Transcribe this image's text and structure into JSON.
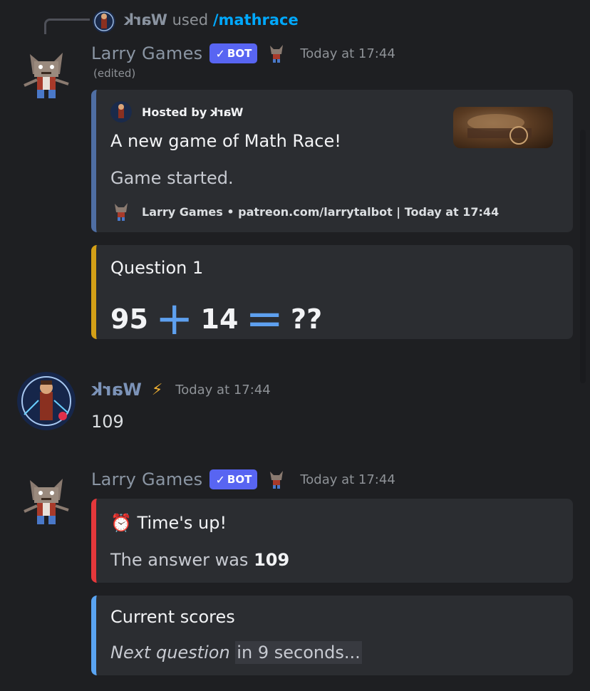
{
  "command": {
    "user": "Wark",
    "used": "used",
    "name": "/mathrace"
  },
  "message1": {
    "author": "Larry Games",
    "bot_tag": "BOT",
    "timestamp": "Today at 17:44",
    "edited": "(edited)",
    "embed1": {
      "author_prefix": "Hosted by",
      "author_name": "Wark",
      "title": "A new game of Math Race!",
      "description": "Game started.",
      "footer": "Larry Games • patreon.com/larrytalbot | Today at 17:44",
      "accent": "#4f6ea3"
    },
    "embed2": {
      "title": "Question 1",
      "a": "95",
      "op": "+",
      "b": "14",
      "eq": "=",
      "result": "??",
      "accent": "#d4a017"
    }
  },
  "message2": {
    "author": "Wark",
    "timestamp": "Today at 17:44",
    "content": "109"
  },
  "message3": {
    "author": "Larry Games",
    "bot_tag": "BOT",
    "timestamp": "Today at 17:44",
    "embed1": {
      "icon": "⏰",
      "title": "Time's up!",
      "desc_prefix": "The answer was",
      "answer": "109",
      "accent": "#e5383b"
    },
    "embed2": {
      "title": "Current scores",
      "next_italic": "Next question",
      "next_in": "in",
      "next_rest": "9 seconds...",
      "accent": "#5aa4f2"
    }
  }
}
